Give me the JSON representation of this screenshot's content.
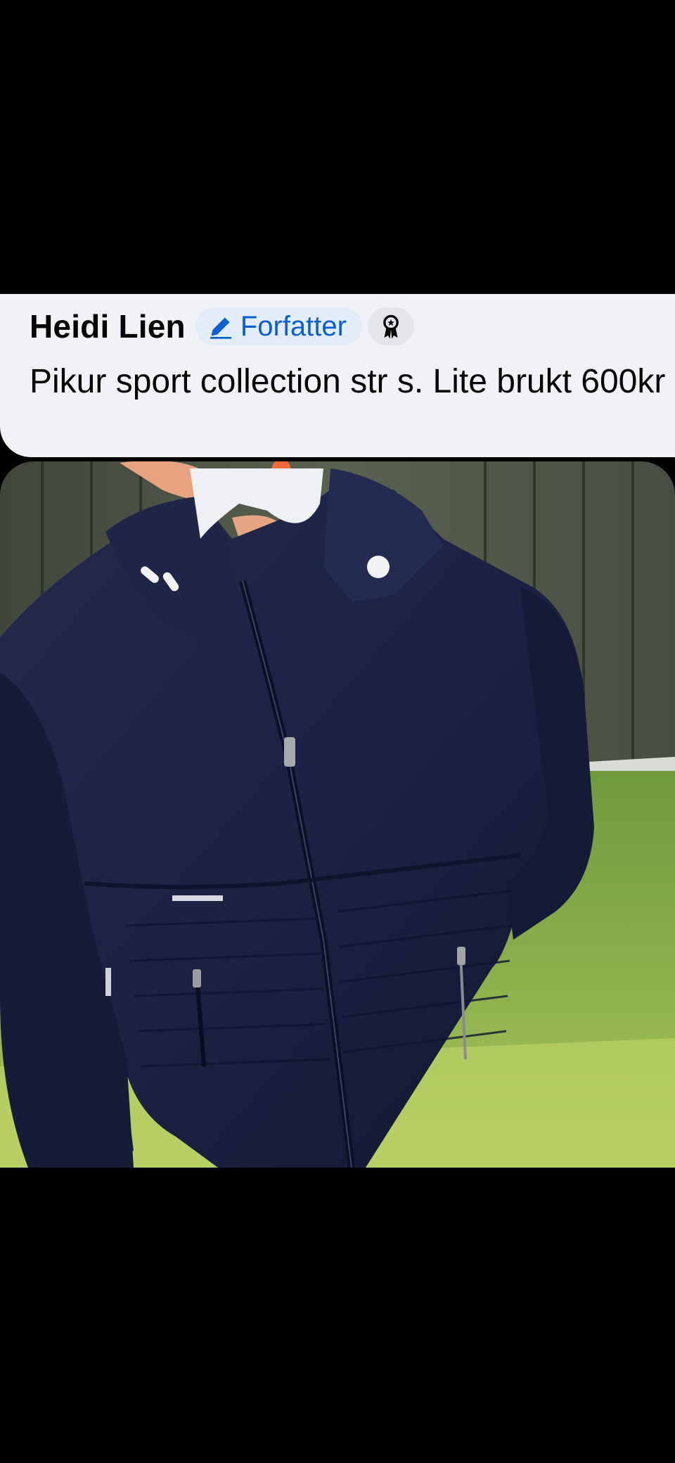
{
  "comment": {
    "author_name": "Heidi Lien",
    "author_badge_label": "Forfatter",
    "author_badge_icon": "pencil-icon",
    "award_badge_icon": "award-ribbon-icon",
    "text": "Pikur sport collection str s. Lite brukt 600kr"
  },
  "photo": {
    "subject": "navy jacket on hanger",
    "jacket_color": "#1b2140",
    "fence_color": "#4a5244",
    "grass_color": "#7ea64a"
  }
}
